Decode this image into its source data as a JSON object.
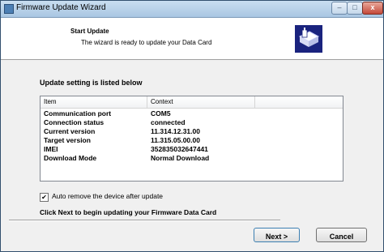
{
  "window": {
    "title": "Firmware Update Wizard",
    "min_glyph": "–",
    "max_glyph": "□",
    "close_glyph": "x"
  },
  "header": {
    "title": "Start Update",
    "subtitle": "The wizard is ready to update your Data Card",
    "logo_icon": "device-usb-icon"
  },
  "section_label": "Update setting is listed below",
  "list": {
    "columns": [
      "Item",
      "Context",
      ""
    ],
    "rows": [
      {
        "item": "Communication port",
        "context": "COM5"
      },
      {
        "item": "Connection status",
        "context": "connected"
      },
      {
        "item": "Current version",
        "context": "11.314.12.31.00"
      },
      {
        "item": "Target version",
        "context": "11.315.05.00.00"
      },
      {
        "item": "IMEI",
        "context": "352835032647441"
      },
      {
        "item": "Download Mode",
        "context": "Normal Download"
      }
    ]
  },
  "auto_remove": {
    "checked": true,
    "label": "Auto remove the device after update",
    "check_glyph": "✔"
  },
  "hint": "Click Next to begin updating your Firmware Data Card",
  "buttons": {
    "next": "Next >",
    "cancel": "Cancel"
  },
  "colors": {
    "logo_bg": "#1a237e",
    "titlebar": "#b9d1ea",
    "close": "#c4493a"
  }
}
